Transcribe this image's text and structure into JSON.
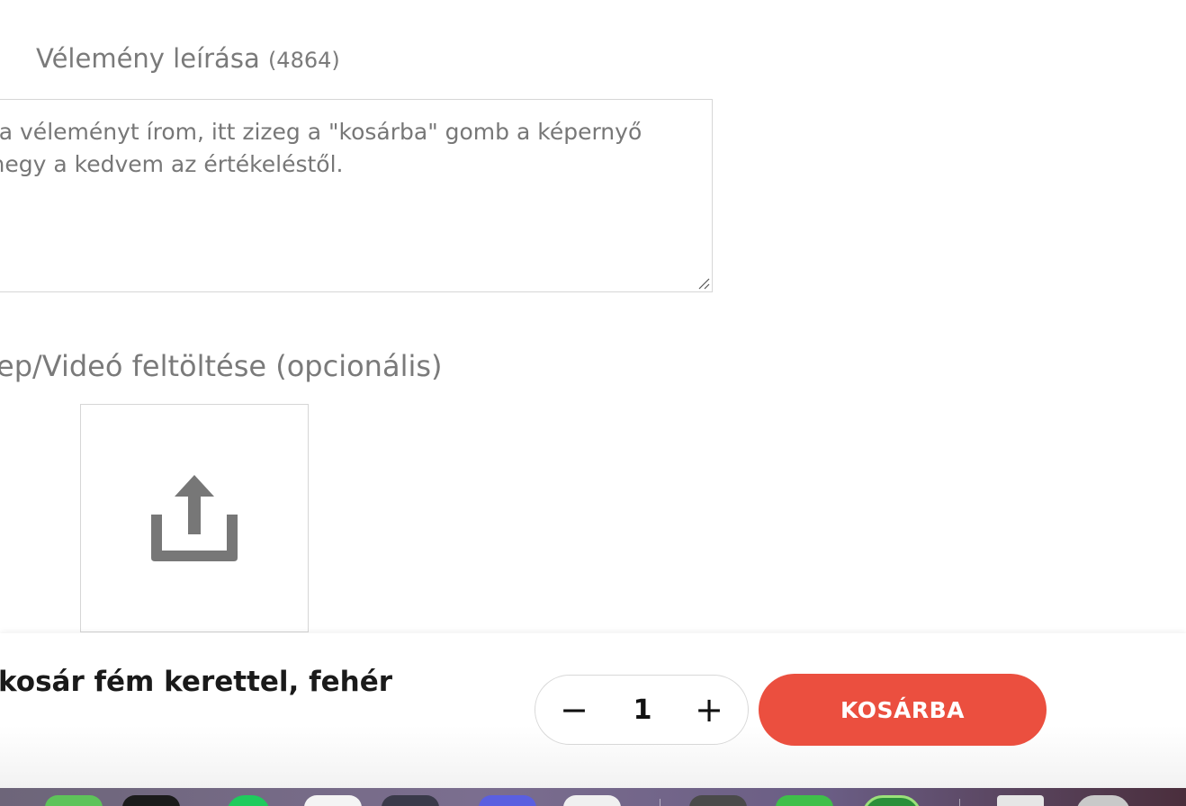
{
  "review": {
    "label": "Vélemény leírása",
    "count": "(4864)",
    "text_line1": "t a véleményt írom, itt zizeg a \"kosárba\" gomb a képernyő",
    "text_line2": "megy a kedvem az értékeléstől."
  },
  "upload": {
    "label": "ep/Videó feltöltése (opcionális)",
    "icon": "upload-icon"
  },
  "sticky_bar": {
    "product_title": "kosár fém kerettel, fehér",
    "quantity": "1",
    "minus_symbol": "−",
    "plus_symbol": "+",
    "cart_label": "KOSÁRBA"
  },
  "colors": {
    "accent": "#eb4f3f",
    "label_gray": "#7a7a7a",
    "border": "#d6d6d6"
  }
}
